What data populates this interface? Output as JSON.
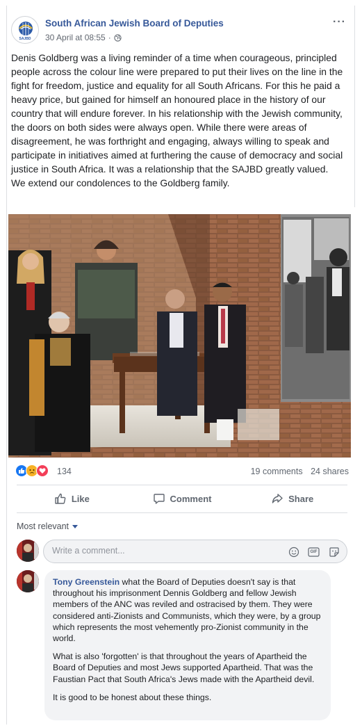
{
  "post": {
    "page_name": "South African Jewish Board of Deputies",
    "avatar_text": "SAJBD",
    "timestamp": "30 April at 08:55",
    "separator": "·",
    "more_label": "···",
    "paragraphs": [
      "Denis Goldberg was a living reminder of a time when courageous, principled people across the colour line were prepared to put their lives on the line in the fight for freedom, justice and equality for all South Africans. For this he paid a heavy price, but gained for himself an honoured place in the history of our country that will endure forever. In his relationship with the Jewish community, the doors on both sides were always open. While there were areas of disagreement, he was forthright and engaging, always willing to speak and participate in initiatives aimed at furthering the cause of democracy and social justice in South Africa. It was a relationship that the SAJBD greatly valued.",
      "We extend our condolences to the Goldberg family."
    ]
  },
  "reactions": {
    "icons": [
      "like-icon",
      "sad-icon",
      "love-icon"
    ],
    "colors": {
      "like": "#1877f2",
      "sad": "#f7b125",
      "love": "#f33e58"
    },
    "count": "134",
    "comments": "19 comments",
    "shares": "24 shares"
  },
  "actions": {
    "like": "Like",
    "comment": "Comment",
    "share": "Share"
  },
  "comments_section": {
    "sort_label": "Most relevant",
    "input_placeholder": "Write a comment...",
    "input_icons": [
      "emoji-icon",
      "gif-icon",
      "sticker-icon"
    ],
    "gif_text": "GIF"
  },
  "comment": {
    "author": "Tony Greenstein",
    "paragraph1": " what the Board of Deputies doesn't say is that throughout his imprisonment Dennis Goldberg and fellow Jewish members of the ANC was reviled and ostracised by them. They were considered anti-Zionists and Communists, which they were, by a group which represents the most vehemently pro-Zionist community in the world.",
    "paragraph2": "What is also 'forgotten' is that throughout the years of Apartheid the Board of Deputies and most Jews supported Apartheid. That was the Faustian Pact that South Africa's Jews made with the Apartheid devil.",
    "paragraph3": "It is good to be honest about these things."
  },
  "colors": {
    "link": "#365899",
    "secondary_text": "#606770"
  }
}
